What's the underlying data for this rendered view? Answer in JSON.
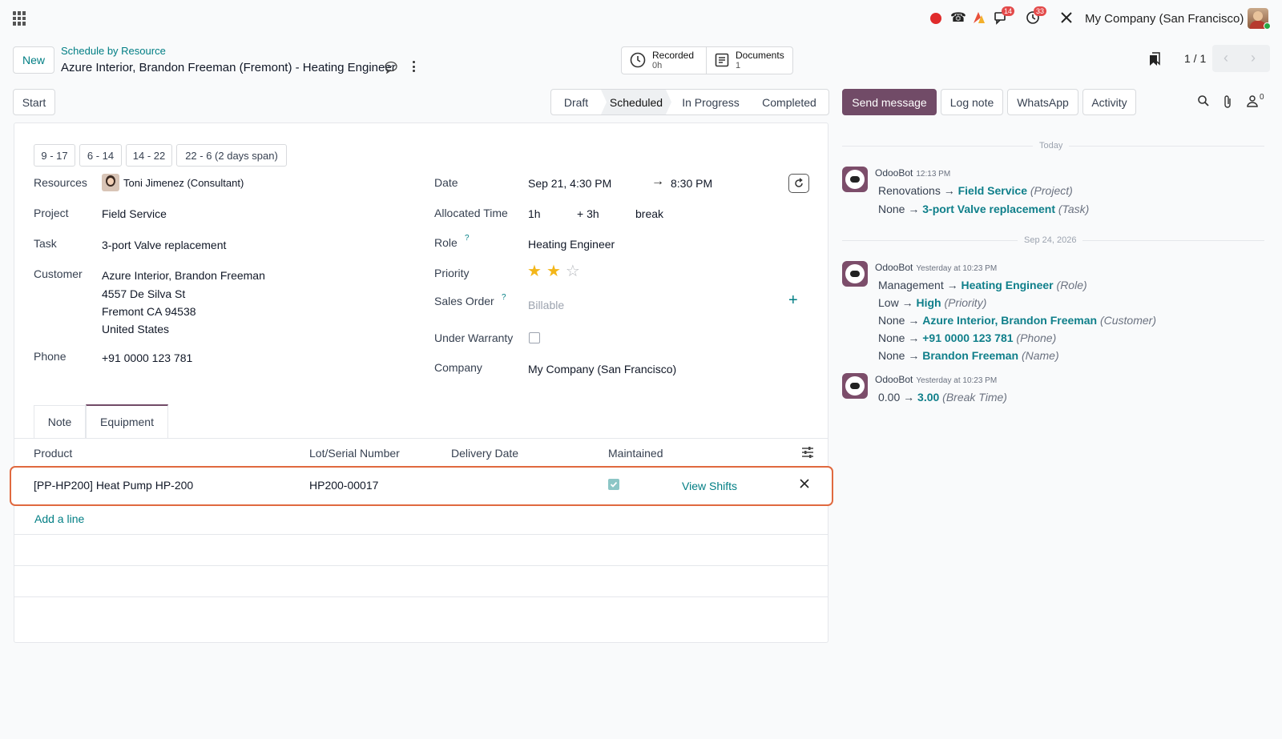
{
  "topbar": {
    "badge_chat": "14",
    "badge_activity": "33",
    "company": "My Company (San Francisco)"
  },
  "breadcrumb": {
    "new_label": "New",
    "parent": "Schedule by Resource",
    "title": "Azure Interior, Brandon Freeman (Fremont) - Heating Engineer"
  },
  "smart_buttons": {
    "recorded_label": "Recorded",
    "recorded_value": "0h",
    "documents_label": "Documents",
    "documents_value": "1"
  },
  "pager": {
    "value": "1 / 1"
  },
  "actions": {
    "start": "Start"
  },
  "statusbar": [
    "Draft",
    "Scheduled",
    "In Progress",
    "Completed"
  ],
  "statusbar_active": "Scheduled",
  "chatter_buttons": {
    "send": "Send message",
    "log": "Log note",
    "whatsapp": "WhatsApp",
    "activity": "Activity",
    "followers": "0"
  },
  "shift_templates": [
    "9 - 17",
    "6 - 14",
    "14 - 22",
    "22 - 6 (2 days span)"
  ],
  "form": {
    "resources_label": "Resources",
    "resources_value": "Toni Jimenez (Consultant)",
    "project_label": "Project",
    "project_value": "Field Service",
    "task_label": "Task",
    "task_value": "3-port Valve replacement",
    "customer_label": "Customer",
    "customer_line1": "Azure Interior, Brandon Freeman",
    "customer_line2": "4557 De Silva St",
    "customer_line3": "Fremont CA 94538",
    "customer_line4": "United States",
    "phone_label": "Phone",
    "phone_value": "+91 0000 123 781",
    "date_label": "Date",
    "date_start": "Sep 21, 4:30 PM",
    "date_end": "8:30 PM",
    "alloc_label": "Allocated Time",
    "alloc_value": "1h",
    "alloc_extra": "+ 3h",
    "alloc_break": "break",
    "role_label": "Role",
    "role_help": "?",
    "role_value": "Heating Engineer",
    "priority_label": "Priority",
    "priority_stars": 2,
    "priority_max": 3,
    "sales_label": "Sales Order",
    "sales_help": "?",
    "sales_placeholder": "Billable",
    "warranty_label": "Under Warranty",
    "company_label": "Company",
    "company_value": "My Company (San Francisco)"
  },
  "tabs": [
    "Note",
    "Equipment"
  ],
  "tabs_active": "Equipment",
  "table": {
    "headers": [
      "Product",
      "Lot/Serial Number",
      "Delivery Date",
      "Maintained"
    ],
    "row": {
      "product": "[PP-HP200] Heat Pump HP-200",
      "lot": "HP200-00017",
      "delivery": "",
      "maintained": true,
      "action": "View Shifts"
    },
    "add_line": "Add a line"
  },
  "chatter": {
    "today": "Today",
    "date2": "Sep 24, 2026",
    "messages": [
      {
        "author": "OdooBot",
        "time": "12:13 PM",
        "changes": [
          {
            "old": "Renovations",
            "new": "Field Service",
            "field": "(Project)"
          },
          {
            "old": "None",
            "new": "3-port Valve replacement",
            "field": "(Task)"
          }
        ]
      },
      {
        "author": "OdooBot",
        "time": "Yesterday at 10:23 PM",
        "changes": [
          {
            "old": "Management",
            "new": "Heating Engineer",
            "field": "(Role)"
          },
          {
            "old": "Low",
            "new": "High",
            "field": "(Priority)"
          },
          {
            "old": "None",
            "new": "Azure Interior, Brandon Freeman",
            "field": "(Customer)"
          },
          {
            "old": "None",
            "new": "+91 0000 123 781",
            "field": "(Phone)"
          },
          {
            "old": "None",
            "new": "Brandon Freeman",
            "field": "(Name)"
          }
        ]
      },
      {
        "author": "OdooBot",
        "time": "Yesterday at 10:23 PM",
        "changes": [
          {
            "old": "0.00",
            "new": "3.00",
            "field": "(Break Time)"
          }
        ]
      }
    ]
  },
  "colors": {
    "accent": "#714b67",
    "teal": "#017e84",
    "highlight": "#e0693f"
  }
}
